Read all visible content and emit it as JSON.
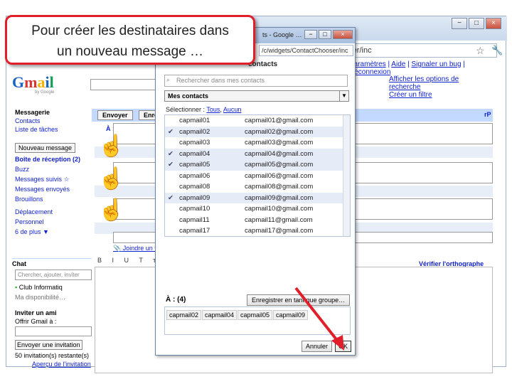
{
  "callout": {
    "line1": "Pour créer les destinataires dans",
    "line2": "un nouveau message …"
  },
  "browser": {
    "url": "/c/widgets/ContactChooser/inc",
    "window_controls": [
      "−",
      "□",
      "×"
    ]
  },
  "gmail": {
    "logo": {
      "l1": "G",
      "l2": "m",
      "l3": "a",
      "l4": "i",
      "l5": "l",
      "sub": "by Google"
    },
    "top_links": [
      "Paramètres",
      "Aide",
      "Signaler un bug",
      "Déconnexion"
    ],
    "search_options": [
      "Afficher les options de",
      "recherche",
      "Créer un filtre"
    ],
    "nav": {
      "messagerie": "Messagerie",
      "contacts": "Contacts",
      "taches": "Liste de tâches",
      "compose": "Nouveau message",
      "inbox": "Boîte de réception (2)",
      "buzz": "Buzz",
      "suivis": "Messages suivis ☆",
      "envoyes": "Messages envoyés",
      "brouillons": "Brouillons",
      "deplacement": "Déplacement",
      "personnel": "Personnel",
      "plus": "6 de plus ▼"
    },
    "chat": {
      "heading": "Chat",
      "search_placeholder": "Chercher, ajouter, inviter",
      "status_name": "Club Informatiq",
      "status_msg": "Ma disponibilité…"
    },
    "invite": {
      "heading": "Inviter un ami",
      "offer": "Offrir Gmail à :",
      "button": "Envoyer une invitation",
      "remaining": "50 invitation(s) restante(s)",
      "preview": "Aperçu de l'invitation"
    },
    "compose": {
      "send": "Envoyer",
      "draft": "Enre",
      "rp": "rP",
      "to_label": "À :",
      "attach": "Joindre un fic",
      "format_icons": "B I U T ᴛ T",
      "spell": "Vérifier l'orthographe"
    }
  },
  "popup": {
    "title": "ts - Google …",
    "url": "/c/widgets/ContactChooser/inc",
    "heading": "contacts",
    "search_placeholder": "Rechercher dans mes contacts",
    "group": "Mes contacts",
    "select_prefix": "Sélectionner :",
    "select_all": "Tous",
    "select_none": "Aucun",
    "contacts": [
      {
        "name": "capmail01",
        "email": "capmail01@gmail.com",
        "checked": false
      },
      {
        "name": "capmail02",
        "email": "capmail02@gmail.com",
        "checked": true
      },
      {
        "name": "capmail03",
        "email": "capmail03@gmail.com",
        "checked": false
      },
      {
        "name": "capmail04",
        "email": "capmail04@gmail.com",
        "checked": true
      },
      {
        "name": "capmail05",
        "email": "capmail05@gmail.com",
        "checked": true
      },
      {
        "name": "capmail06",
        "email": "capmail06@gmail.com",
        "checked": false
      },
      {
        "name": "capmail08",
        "email": "capmail08@gmail.com",
        "checked": false
      },
      {
        "name": "capmail09",
        "email": "capmail09@gmail.com",
        "checked": true
      },
      {
        "name": "capmail10",
        "email": "capmail10@gmail.com",
        "checked": false
      },
      {
        "name": "capmail11",
        "email": "capmail11@gmail.com",
        "checked": false
      },
      {
        "name": "capmail17",
        "email": "capmail17@gmail.com",
        "checked": false
      }
    ],
    "selected_label": "À : (4)",
    "save_group": "Enregistrer en tant que groupe…",
    "selected": [
      "capmail02",
      "capmail04",
      "capmail05",
      "capmail09"
    ],
    "cancel": "Annuler",
    "ok": "OK"
  },
  "colors": {
    "callout_border": "#e01f2a",
    "arrow": "#e01f2a",
    "gmail_blue": "#c3d9ff"
  }
}
